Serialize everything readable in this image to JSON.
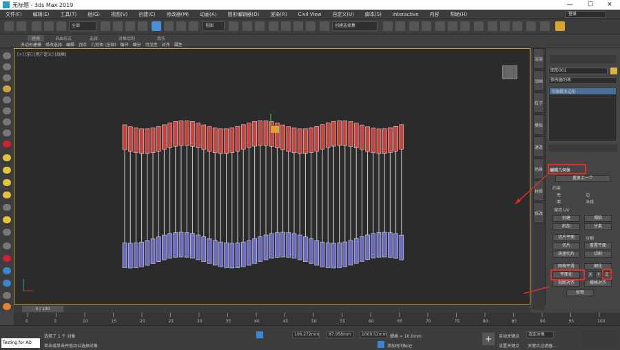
{
  "window": {
    "title": "无标题 - 3ds Max 2019",
    "min": "—",
    "max": "☐",
    "close": "✕"
  },
  "menu": [
    "文件(F)",
    "编辑(E)",
    "工具(T)",
    "组(G)",
    "视图(V)",
    "创建(C)",
    "修改器(M)",
    "动画(A)",
    "图形编辑器(D)",
    "渲染(R)",
    "Civil View",
    "自定义(U)",
    "脚本(S)",
    "Interactive",
    "内容",
    "帮助(H)"
  ],
  "user": "登录",
  "toolbar": {
    "filter": "全部",
    "refcoord": "视图",
    "selset": "创建选择集"
  },
  "ribbon": {
    "tabs": [
      "建模",
      "自由形式",
      "选择",
      "对象绘制",
      "填充"
    ],
    "row": [
      "多边形建模",
      "修改选择",
      "编辑",
      "顶点",
      "几何体 (全部)",
      "循环",
      "细分",
      "可见性",
      "对齐",
      "属性"
    ]
  },
  "viewport": {
    "label": "[+] [前] [用户定义] [线框]"
  },
  "sidetabs": [
    "渲染",
    "动画",
    "粒子",
    "模拟",
    "通道",
    "场景",
    "材质",
    "修改"
  ],
  "cmd": {
    "objname": "图形001",
    "modlist": "修改器列表",
    "stack": "可编辑多边形",
    "rollout": "编辑几何体",
    "repeat": "重复上一个",
    "constraints": "约束",
    "c_none": "无",
    "c_edge": "边",
    "c_face": "面",
    "c_normal": "法线",
    "preserve": "保持 UV",
    "create": "创建",
    "collapse": "塌陷",
    "attach": "附加",
    "detach": "分离",
    "slice_plane": "切片平面",
    "split": "分割",
    "slice": "切片",
    "reset_plane": "重置平面",
    "quickslice": "快速切片",
    "cut": "切割",
    "msmooth": "网格平滑",
    "tessellate": "细化",
    "planar": "平面化",
    "x": "X",
    "y": "Y",
    "z": "Z",
    "view_align": "视图对齐",
    "grid_align": "栅格对齐",
    "relax": "松弛"
  },
  "timeslider": "0 / 100",
  "ticks": [
    "0",
    "5",
    "10",
    "15",
    "20",
    "25",
    "30",
    "35",
    "40",
    "45",
    "50",
    "55",
    "60",
    "65",
    "70",
    "75",
    "80",
    "85",
    "90",
    "95",
    "100"
  ],
  "status": {
    "script": "Testing for AD",
    "sel": "选择了 1 个 对象",
    "hint": "单击或单击并拖动以选择对象",
    "xval": "106.272mm",
    "yval": "87.958mm",
    "zval": "1000.52mm",
    "grid": "栅格 = 10.0mm",
    "addtime": "添加时间标记",
    "autokey": "自动关键点",
    "setkey": "设置关键点",
    "selobj": "选定对象",
    "keyfilter": "关键点过滤器..."
  }
}
